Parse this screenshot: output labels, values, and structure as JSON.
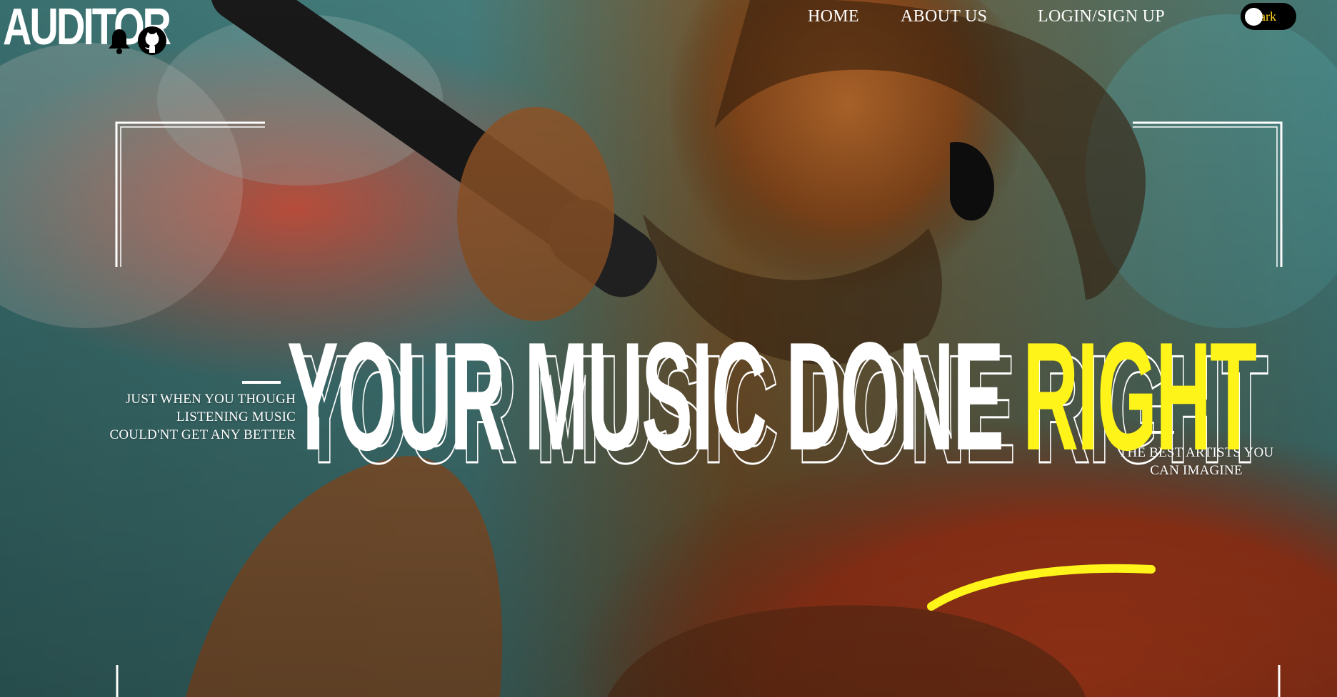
{
  "brand": {
    "logo_text": "AUDITOR"
  },
  "header": {
    "icons": {
      "notifications": "bell-icon",
      "repository": "github-icon"
    },
    "nav": [
      {
        "label": "HOME"
      },
      {
        "label": "ABOUT US"
      },
      {
        "label": "LOGIN/SIGN UP"
      }
    ],
    "theme_toggle": {
      "label": "ark"
    }
  },
  "hero": {
    "headline": {
      "main": "YOUR MUSIC DONE",
      "highlight": "RIGHT"
    },
    "left_tagline": "JUST WHEN YOU THOUGH LISTENING MUSIC COULD'NT GET ANY BETTER",
    "right_tagline": "THE BEST ARTISTS YOU CAN IMAGINE"
  },
  "colors": {
    "accent": "#fff419",
    "toggle_bg": "#000000",
    "toggle_text": "#ffd21a"
  }
}
